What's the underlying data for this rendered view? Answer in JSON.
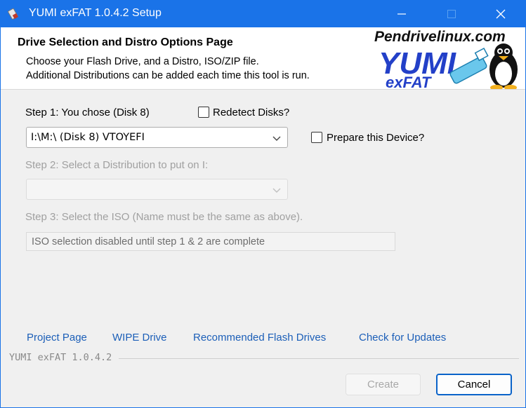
{
  "window": {
    "title": "YUMI exFAT 1.0.4.2 Setup",
    "accent_color": "#1a73e8",
    "controls": [
      "minimize-icon",
      "maximize-icon",
      "close-icon"
    ]
  },
  "header": {
    "title": "Drive Selection and Distro Options Page",
    "line1": "Choose your Flash Drive, and a Distro, ISO/ZIP file.",
    "line2": "Additional Distributions can be added each time this tool is run.",
    "logo": {
      "site": "Pendrivelinux.com",
      "brand": "YUMI",
      "sub": "exFAT"
    }
  },
  "step1": {
    "label": "Step 1: You chose (Disk 8)",
    "redetect_label": "Redetect Disks?",
    "drive_value": "I:\\M:\\ (Disk 8)  VTOYEFI",
    "prepare_label": "Prepare this Device?"
  },
  "step2": {
    "label": "Step 2: Select a Distribution to put on I:",
    "value": ""
  },
  "step3": {
    "label": "Step 3: Select the ISO (Name must be the same as above).",
    "iso_text": "ISO selection disabled until step 1 & 2 are complete"
  },
  "links": {
    "project": "Project Page",
    "wipe": "WIPE Drive",
    "recommended": "Recommended Flash Drives",
    "updates": "Check for Updates"
  },
  "footer": {
    "version": "YUMI exFAT 1.0.4.2",
    "create_label": "Create",
    "cancel_label": "Cancel"
  }
}
